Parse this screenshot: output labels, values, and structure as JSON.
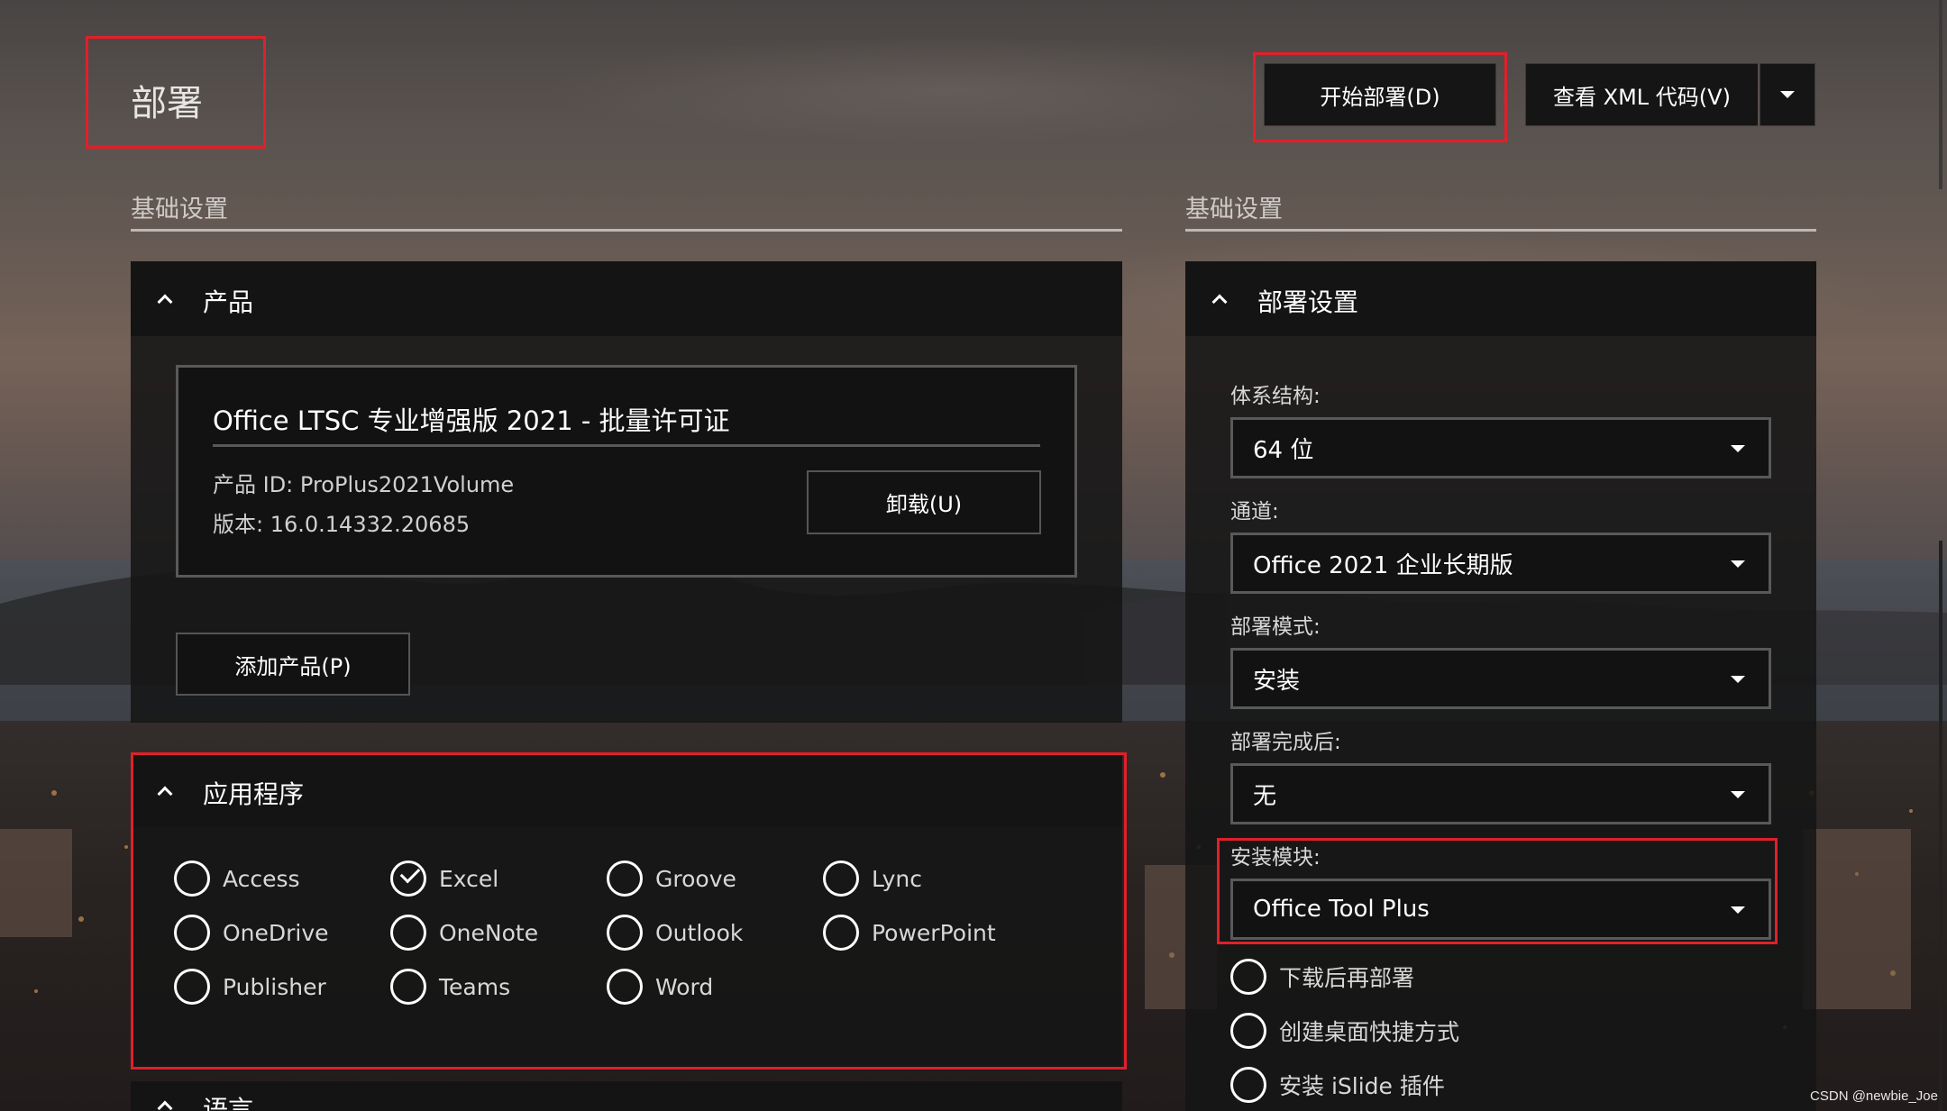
{
  "header": {
    "title": "部署",
    "deploy_button": "开始部署(D)",
    "xml_button": "查看 XML 代码(V)"
  },
  "left": {
    "section_title": "基础设置",
    "product_panel": {
      "title": "产品",
      "product_name": "Office LTSC 专业增强版 2021 - 批量许可证",
      "product_id": "产品 ID: ProPlus2021Volume",
      "version": "版本: 16.0.14332.20685",
      "uninstall_button": "卸载(U)",
      "add_product_button": "添加产品(P)"
    },
    "apps_panel": {
      "title": "应用程序",
      "apps": [
        {
          "label": "Access",
          "checked": false
        },
        {
          "label": "Excel",
          "checked": true
        },
        {
          "label": "Groove",
          "checked": false
        },
        {
          "label": "Lync",
          "checked": false
        },
        {
          "label": "OneDrive",
          "checked": false
        },
        {
          "label": "OneNote",
          "checked": false
        },
        {
          "label": "Outlook",
          "checked": false
        },
        {
          "label": "PowerPoint",
          "checked": false
        },
        {
          "label": "Publisher",
          "checked": false
        },
        {
          "label": "Teams",
          "checked": false
        },
        {
          "label": "Word",
          "checked": false
        }
      ]
    },
    "language_panel": {
      "title": "语言"
    }
  },
  "right": {
    "section_title": "基础设置",
    "deploy_panel": {
      "title": "部署设置",
      "fields": [
        {
          "label": "体系结构:",
          "value": "64 位"
        },
        {
          "label": "通道:",
          "value": "Office 2021 企业长期版"
        },
        {
          "label": "部署模式:",
          "value": "安装"
        },
        {
          "label": "部署完成后:",
          "value": "无"
        },
        {
          "label": "安装模块:",
          "value": "Office Tool Plus"
        }
      ],
      "options": [
        {
          "label": "下载后再部署",
          "checked": false
        },
        {
          "label": "创建桌面快捷方式",
          "checked": false
        },
        {
          "label": "安装 iSlide 插件",
          "checked": false
        }
      ]
    }
  },
  "watermark": "CSDN @newbie_Joe",
  "colors": {
    "highlight": "#e0202a",
    "panel": "#141414",
    "text": "#ffffff"
  }
}
